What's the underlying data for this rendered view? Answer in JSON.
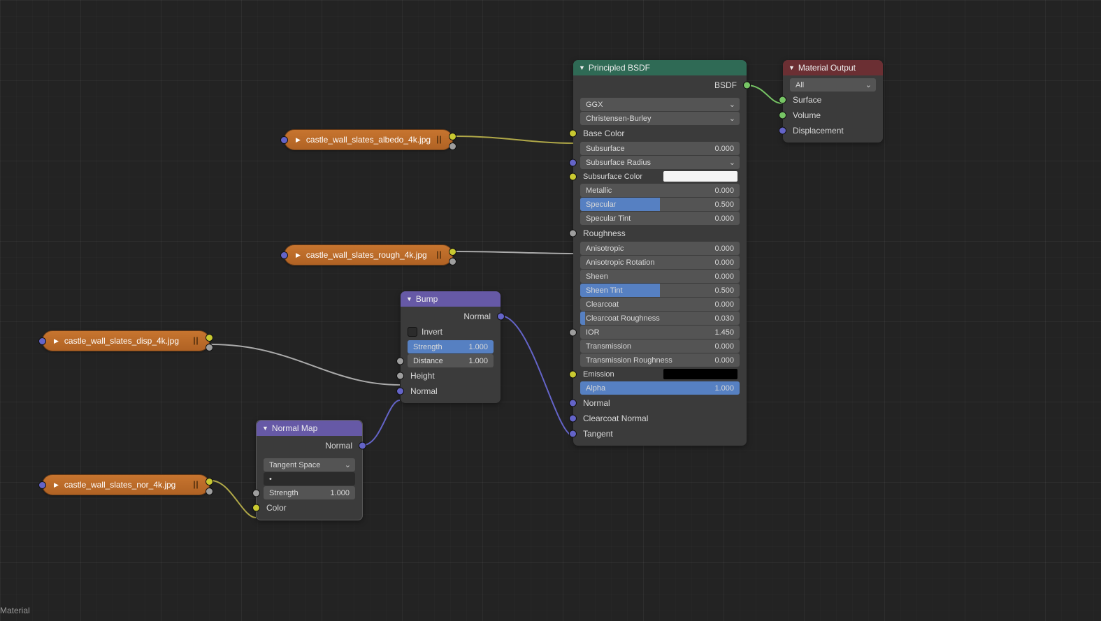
{
  "status_text": "Material",
  "textures": {
    "albedo": "castle_wall_slates_albedo_4k.jpg",
    "rough": "castle_wall_slates_rough_4k.jpg",
    "disp": "castle_wall_slates_disp_4k.jpg",
    "nor": "castle_wall_slates_nor_4k.jpg"
  },
  "bump": {
    "title": "Bump",
    "out_normal": "Normal",
    "invert": "Invert",
    "strength_l": "Strength",
    "strength_v": "1.000",
    "distance_l": "Distance",
    "distance_v": "1.000",
    "height": "Height",
    "normal": "Normal"
  },
  "normal_map": {
    "title": "Normal Map",
    "out_normal": "Normal",
    "space": "Tangent Space",
    "uvmap": "•",
    "strength_l": "Strength",
    "strength_v": "1.000",
    "color": "Color"
  },
  "bsdf": {
    "title": "Principled BSDF",
    "out_bsdf": "BSDF",
    "distribution": "GGX",
    "sss_method": "Christensen-Burley",
    "base_color": "Base Color",
    "subsurface_l": "Subsurface",
    "subsurface_v": "0.000",
    "subsurface_radius": "Subsurface Radius",
    "subsurface_color": "Subsurface Color",
    "metallic_l": "Metallic",
    "metallic_v": "0.000",
    "specular_l": "Specular",
    "specular_v": "0.500",
    "specular_tint_l": "Specular Tint",
    "specular_tint_v": "0.000",
    "roughness": "Roughness",
    "anisotropic_l": "Anisotropic",
    "anisotropic_v": "0.000",
    "aniso_rot_l": "Anisotropic Rotation",
    "aniso_rot_v": "0.000",
    "sheen_l": "Sheen",
    "sheen_v": "0.000",
    "sheen_tint_l": "Sheen Tint",
    "sheen_tint_v": "0.500",
    "clearcoat_l": "Clearcoat",
    "clearcoat_v": "0.000",
    "clearcoat_rough_l": "Clearcoat Roughness",
    "clearcoat_rough_v": "0.030",
    "ior_l": "IOR",
    "ior_v": "1.450",
    "transmission_l": "Transmission",
    "transmission_v": "0.000",
    "trans_rough_l": "Transmission Roughness",
    "trans_rough_v": "0.000",
    "emission": "Emission",
    "alpha_l": "Alpha",
    "alpha_v": "1.000",
    "normal": "Normal",
    "clearcoat_normal": "Clearcoat Normal",
    "tangent": "Tangent"
  },
  "output": {
    "title": "Material Output",
    "target": "All",
    "surface": "Surface",
    "volume": "Volume",
    "displacement": "Displacement"
  }
}
